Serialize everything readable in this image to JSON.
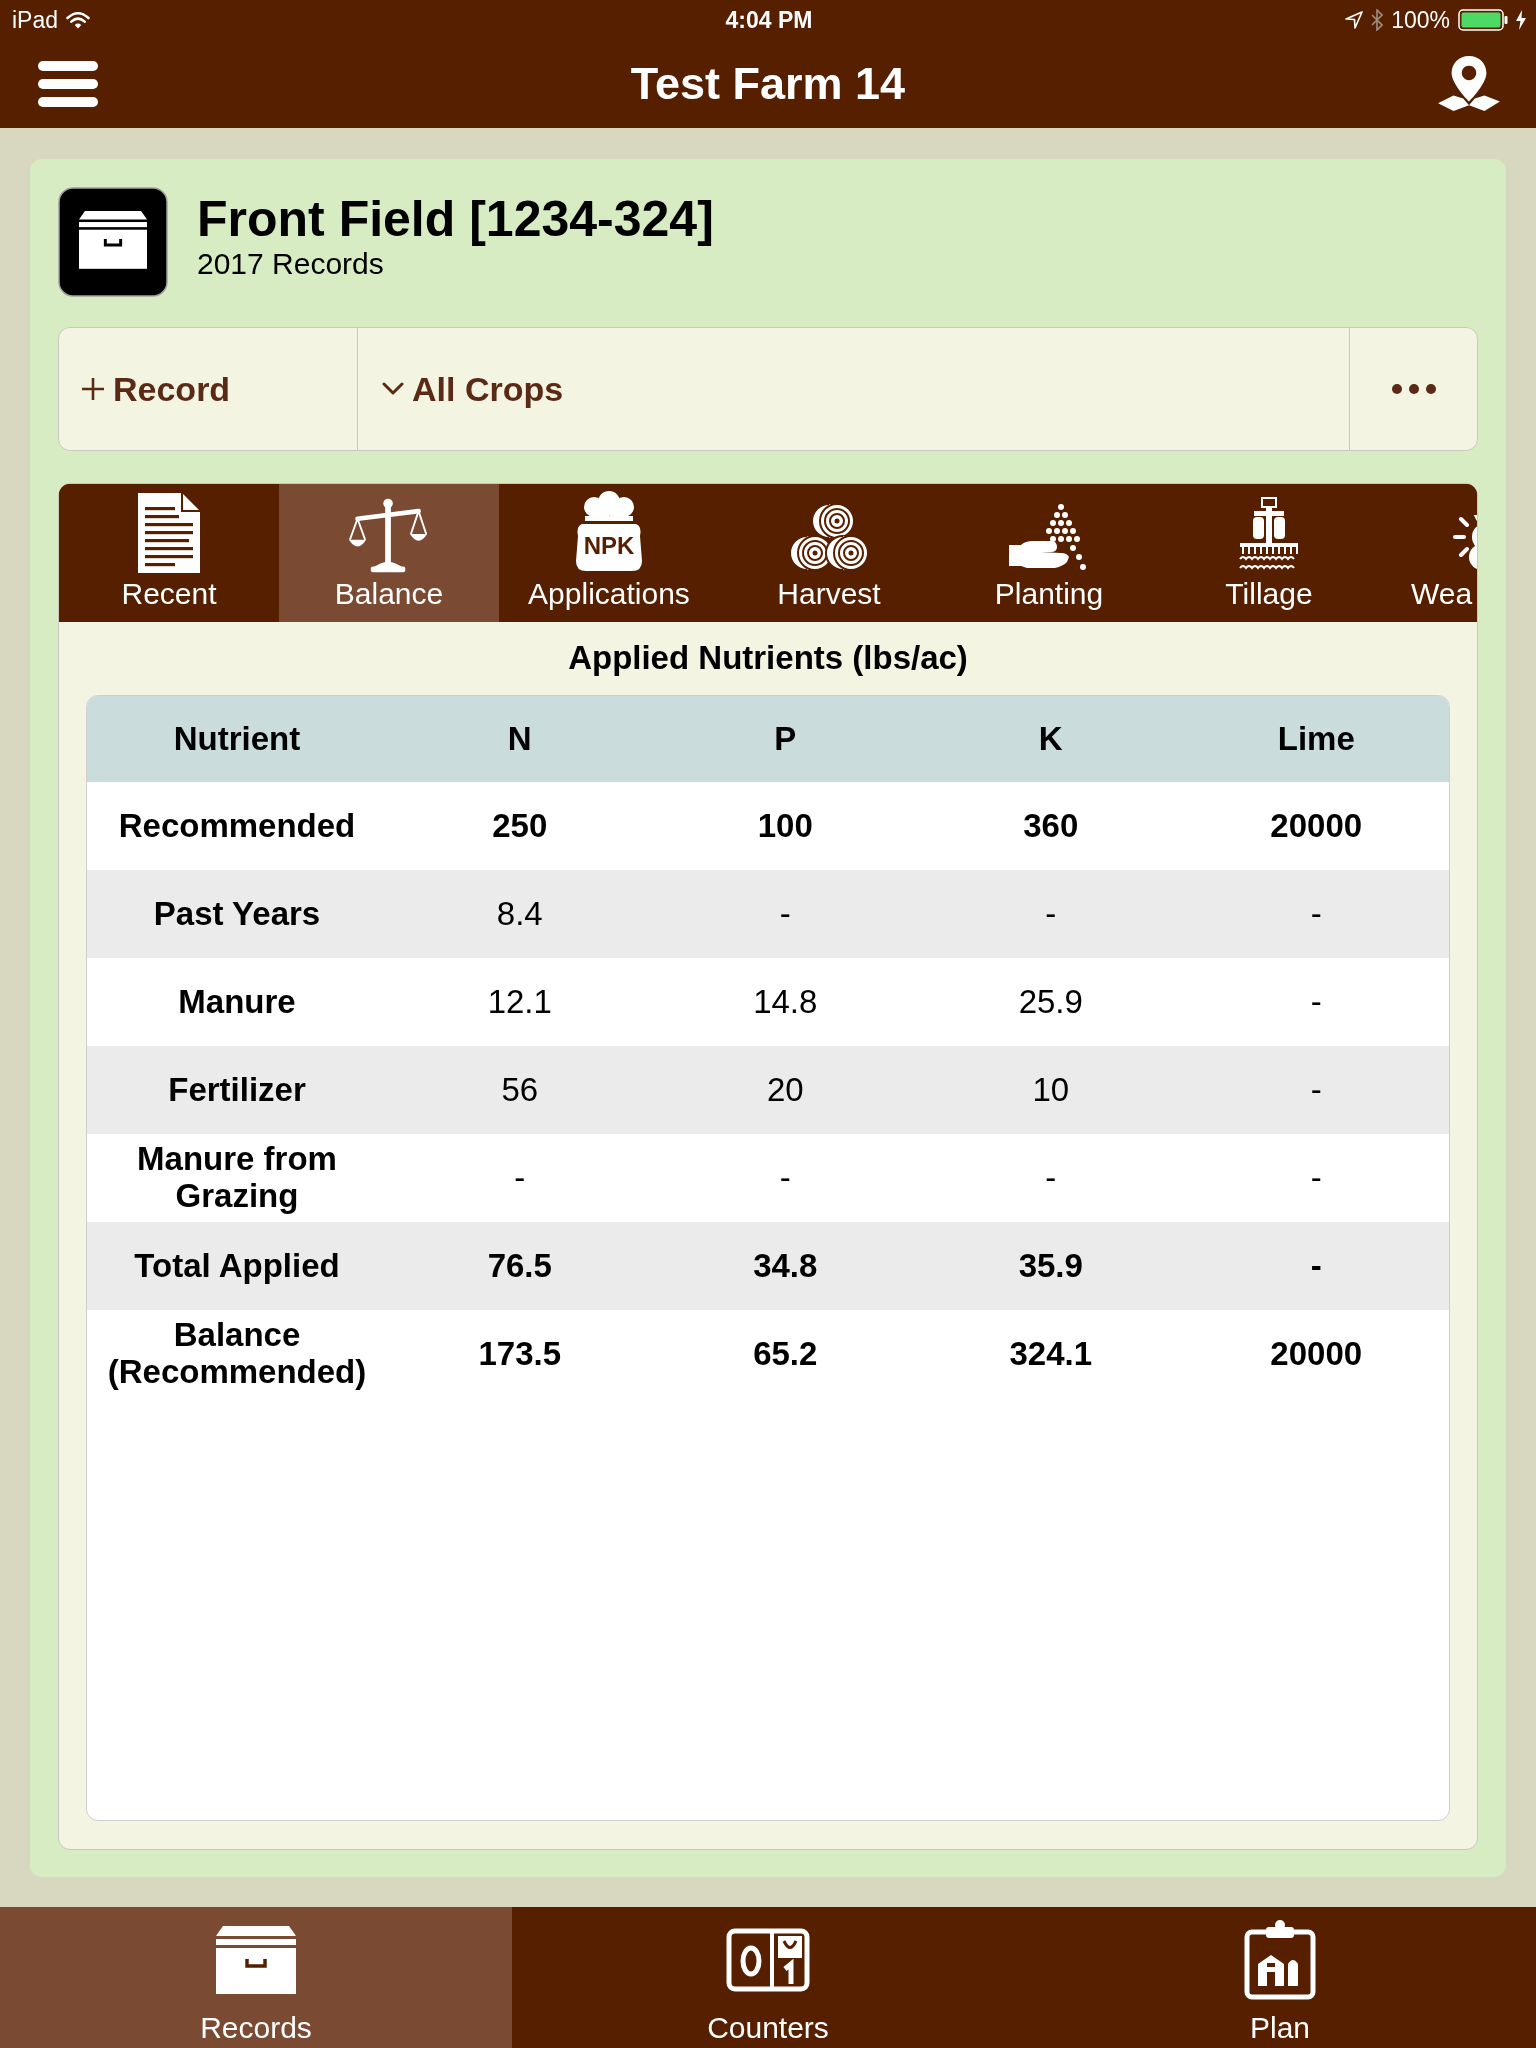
{
  "status_bar": {
    "carrier": "iPad",
    "time": "4:04 PM",
    "battery": "100%"
  },
  "nav_bar": {
    "title": "Test Farm 14"
  },
  "field": {
    "title": "Front Field [1234-324]",
    "subtitle": "2017 Records"
  },
  "toolbar": {
    "add_label": "Record",
    "filter_label": "All Crops"
  },
  "tabs": [
    {
      "label": "Recent",
      "selected": false
    },
    {
      "label": "Balance",
      "selected": true
    },
    {
      "label": "Applications",
      "selected": false,
      "icon_text": "NPK"
    },
    {
      "label": "Harvest",
      "selected": false
    },
    {
      "label": "Planting",
      "selected": false
    },
    {
      "label": "Tillage",
      "selected": false
    },
    {
      "label": "Wea",
      "selected": false
    }
  ],
  "table": {
    "caption": "Applied Nutrients (lbs/ac)",
    "columns": [
      "Nutrient",
      "N",
      "P",
      "K",
      "Lime"
    ],
    "rows": [
      {
        "label": "Recommended",
        "values": [
          "250",
          "100",
          "360",
          "20000"
        ],
        "emphasized": true
      },
      {
        "label": "Past Years",
        "values": [
          "8.4",
          "-",
          "-",
          "-"
        ],
        "emphasized": false
      },
      {
        "label": "Manure",
        "values": [
          "12.1",
          "14.8",
          "25.9",
          "-"
        ],
        "emphasized": false
      },
      {
        "label": "Fertilizer",
        "values": [
          "56",
          "20",
          "10",
          "-"
        ],
        "emphasized": false
      },
      {
        "label": "Manure from Grazing",
        "values": [
          "-",
          "-",
          "-",
          "-"
        ],
        "emphasized": false
      },
      {
        "label": "Total Applied",
        "values": [
          "76.5",
          "34.8",
          "35.9",
          "-"
        ],
        "emphasized": true
      },
      {
        "label": "Balance (Recommended)",
        "values": [
          "173.5",
          "65.2",
          "324.1",
          "20000"
        ],
        "emphasized": true
      }
    ]
  },
  "bottom_tabs": [
    {
      "label": "Records",
      "selected": true
    },
    {
      "label": "Counters",
      "selected": false
    },
    {
      "label": "Plan",
      "selected": false
    }
  ]
}
